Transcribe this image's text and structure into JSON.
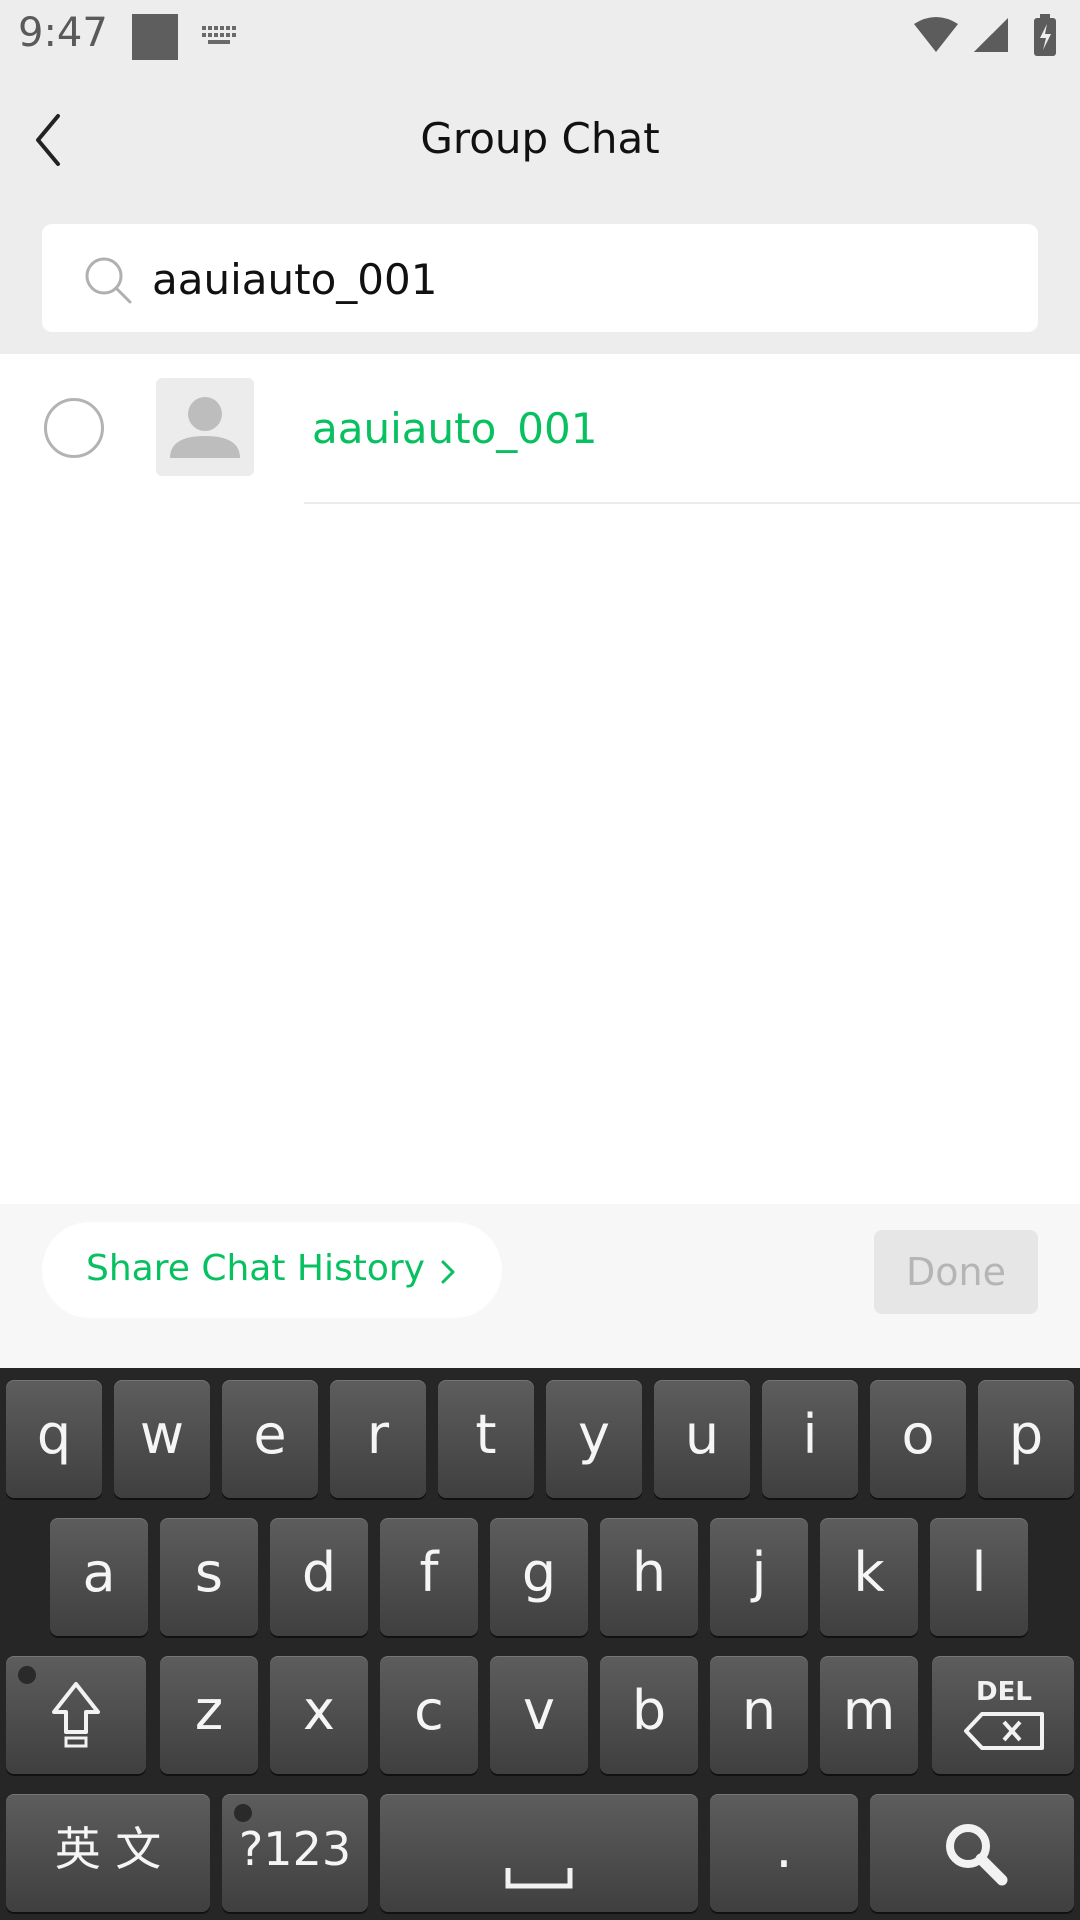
{
  "status_bar": {
    "time": "9:47"
  },
  "header": {
    "title": "Group Chat"
  },
  "search": {
    "value": "aauiauto_001"
  },
  "results": [
    {
      "name": "aauiauto_001",
      "selected": false
    }
  ],
  "bottom_bar": {
    "share_label": "Share Chat History",
    "done_label": "Done"
  },
  "keyboard": {
    "row1": [
      "q",
      "w",
      "e",
      "r",
      "t",
      "y",
      "u",
      "i",
      "o",
      "p"
    ],
    "row2": [
      "a",
      "s",
      "d",
      "f",
      "g",
      "h",
      "j",
      "k",
      "l"
    ],
    "row3": [
      "z",
      "x",
      "c",
      "v",
      "b",
      "n",
      "m"
    ],
    "lang_label": "英 文",
    "symbols_label": "?123",
    "period_label": "."
  },
  "colors": {
    "accent": "#07c160",
    "header_bg": "#ededed"
  },
  "icons": {
    "back": "chevron-left-icon",
    "search": "magnifier-icon",
    "shift": "shift-arrow-icon",
    "delete": "delete-icon",
    "space": "space-icon",
    "enter": "search-icon"
  }
}
